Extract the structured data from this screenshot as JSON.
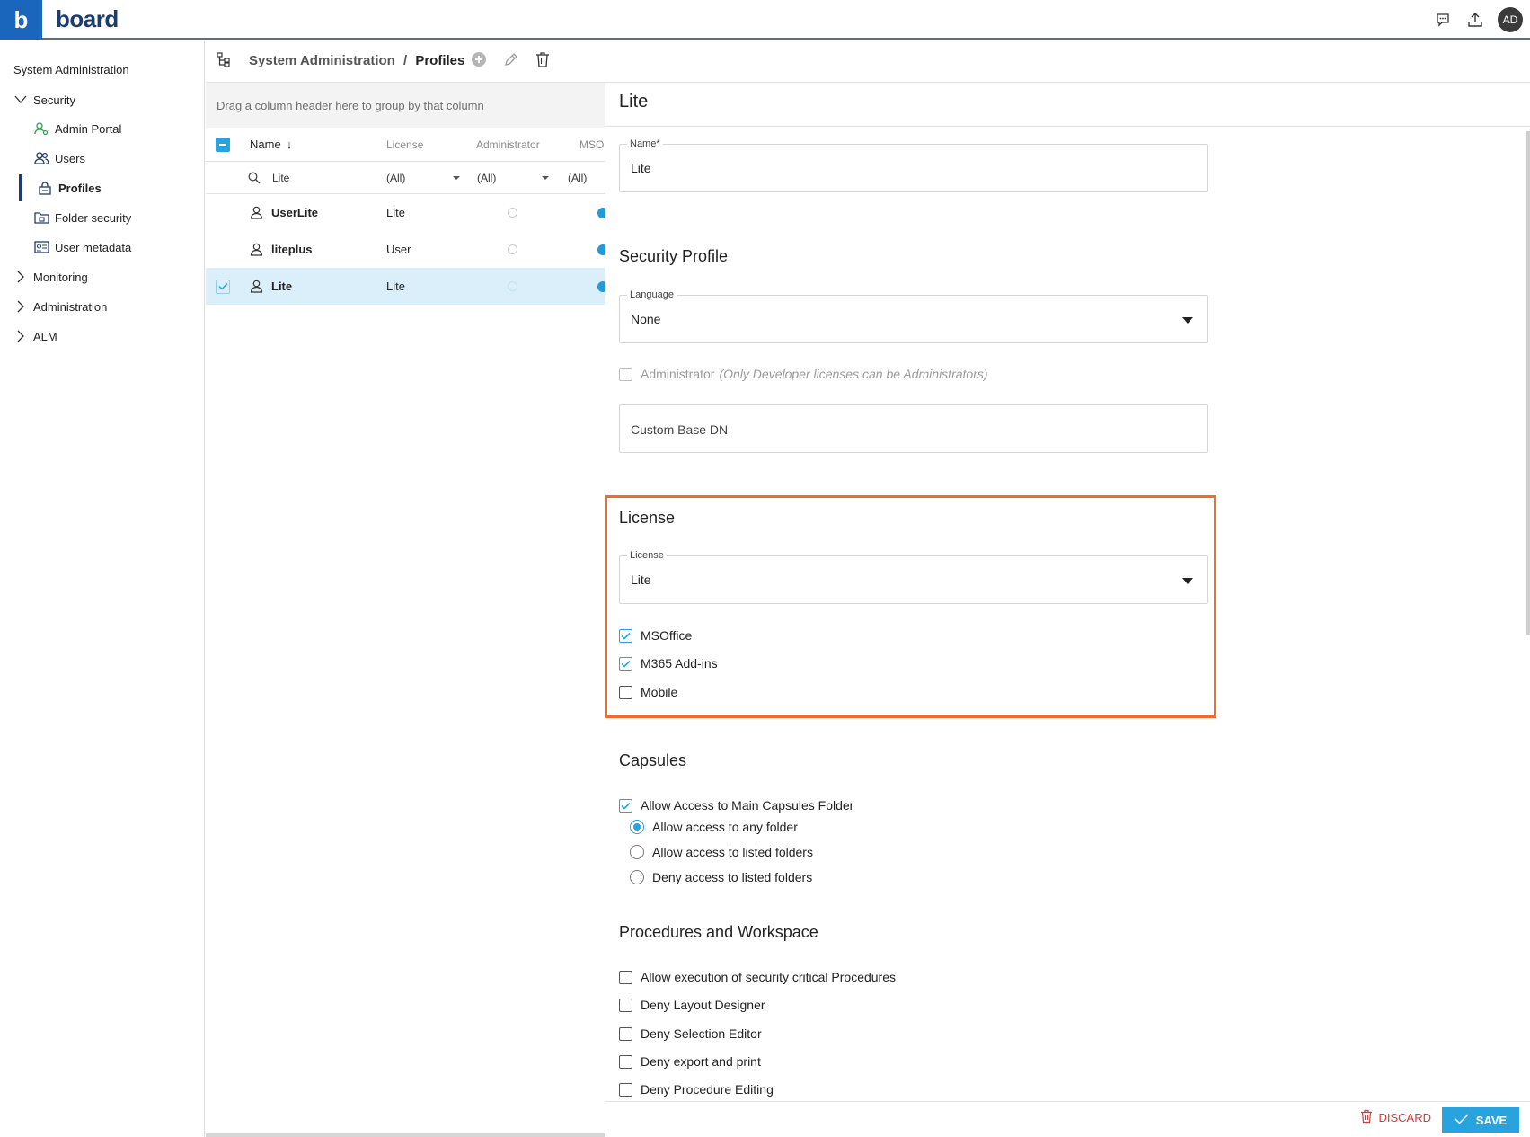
{
  "app": {
    "logo_letter": "b",
    "brand_name": "board",
    "avatar_initials": "AD"
  },
  "sidebar": {
    "title": "System Administration",
    "items": [
      {
        "label": "Security",
        "icon": "chevron-down-icon"
      },
      {
        "label": "Admin Portal",
        "icon": "admin-portal-icon"
      },
      {
        "label": "Users",
        "icon": "users-icon"
      },
      {
        "label": "Profiles",
        "icon": "profiles-icon"
      },
      {
        "label": "Folder security",
        "icon": "folder-security-icon"
      },
      {
        "label": "User metadata",
        "icon": "user-metadata-icon"
      },
      {
        "label": "Monitoring",
        "icon": "chevron-right-icon"
      },
      {
        "label": "Administration",
        "icon": "chevron-right-icon"
      },
      {
        "label": "ALM",
        "icon": "chevron-right-icon"
      }
    ]
  },
  "breadcrumb": {
    "parent": "System Administration",
    "separator": "/",
    "current": "Profiles"
  },
  "grid": {
    "group_hint": "Drag a column header here to group by that column",
    "columns": [
      "Name",
      "License",
      "Administrator",
      "MSO"
    ],
    "sort_arrow": "↓",
    "filters": {
      "name": "Lite",
      "license": "(All)",
      "administrator": "(All)",
      "mso": "(All)"
    },
    "rows": [
      {
        "name": "UserLite",
        "license": "Lite",
        "selected": false
      },
      {
        "name": "liteplus",
        "license": "User",
        "selected": false
      },
      {
        "name": "Lite",
        "license": "Lite",
        "selected": true
      }
    ]
  },
  "panel": {
    "title": "Lite",
    "name_field": {
      "label": "Name*",
      "value": "Lite"
    },
    "security_profile": {
      "title": "Security Profile",
      "language": {
        "label": "Language",
        "value": "None"
      },
      "administrator_label": "Administrator",
      "administrator_note": "(Only Developer licenses can be Administrators)",
      "custom_base_dn_placeholder": "Custom Base DN"
    },
    "license": {
      "title": "License",
      "select": {
        "label": "License",
        "value": "Lite"
      },
      "options": [
        {
          "label": "MSOffice",
          "checked": true
        },
        {
          "label": "M365 Add-ins",
          "checked": true
        },
        {
          "label": "Mobile",
          "checked": false
        }
      ]
    },
    "capsules": {
      "title": "Capsules",
      "main_access_label": "Allow Access to Main Capsules Folder",
      "radios": [
        {
          "label": "Allow access to any folder",
          "checked": true
        },
        {
          "label": "Allow access to listed folders",
          "checked": false
        },
        {
          "label": "Deny access to listed folders",
          "checked": false
        }
      ]
    },
    "procedures": {
      "title": "Procedures and Workspace",
      "options": [
        "Allow execution of security critical Procedures",
        "Deny Layout Designer",
        "Deny Selection Editor",
        "Deny export and print",
        "Deny Procedure Editing"
      ]
    }
  },
  "footer": {
    "discard_label": "DISCARD",
    "save_label": "SAVE"
  },
  "colors": {
    "accent": "#29a3dd",
    "brand": "#1d3c6e",
    "highlight_frame": "#f26b2a",
    "danger": "#d7393b"
  }
}
